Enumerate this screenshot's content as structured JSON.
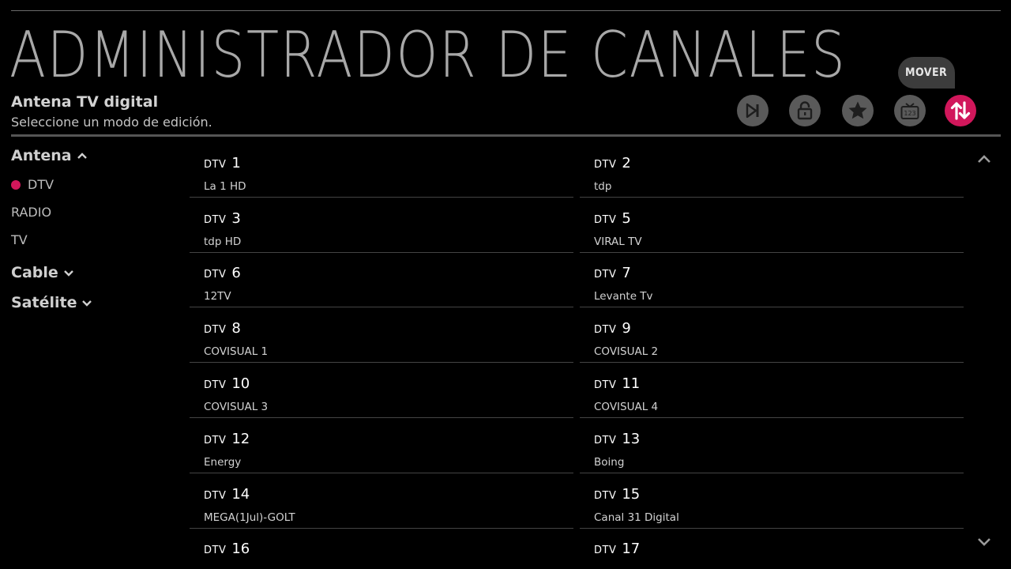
{
  "header": {
    "title": "ADMINISTRADOR DE CANALES",
    "source": "Antena TV digital",
    "subtitle": "Seleccione un modo de edición."
  },
  "toolbar": {
    "tooltip": "MOVER",
    "buttons": [
      {
        "name": "skip",
        "icon": "skip-icon"
      },
      {
        "name": "lock",
        "icon": "lock-icon"
      },
      {
        "name": "favorite",
        "icon": "star-icon"
      },
      {
        "name": "number",
        "icon": "tv-number-icon"
      },
      {
        "name": "move",
        "icon": "move-arrows-icon",
        "active": true
      }
    ],
    "accent_color": "#d1175b"
  },
  "sidebar": {
    "groups": [
      {
        "label": "Antena",
        "expanded": true,
        "items": [
          "DTV",
          "RADIO",
          "TV"
        ],
        "selected": "DTV"
      },
      {
        "label": "Cable",
        "expanded": false
      },
      {
        "label": "Satélite",
        "expanded": false
      }
    ]
  },
  "channels": [
    {
      "type": "DTV",
      "number": "1",
      "name": "La 1 HD"
    },
    {
      "type": "DTV",
      "number": "2",
      "name": "tdp"
    },
    {
      "type": "DTV",
      "number": "3",
      "name": "tdp HD"
    },
    {
      "type": "DTV",
      "number": "5",
      "name": "VIRAL TV"
    },
    {
      "type": "DTV",
      "number": "6",
      "name": "12TV"
    },
    {
      "type": "DTV",
      "number": "7",
      "name": "Levante Tv"
    },
    {
      "type": "DTV",
      "number": "8",
      "name": "COVISUAL 1"
    },
    {
      "type": "DTV",
      "number": "9",
      "name": "COVISUAL 2"
    },
    {
      "type": "DTV",
      "number": "10",
      "name": "COVISUAL 3"
    },
    {
      "type": "DTV",
      "number": "11",
      "name": "COVISUAL 4"
    },
    {
      "type": "DTV",
      "number": "12",
      "name": "Energy"
    },
    {
      "type": "DTV",
      "number": "13",
      "name": "Boing"
    },
    {
      "type": "DTV",
      "number": "14",
      "name": "MEGA(1Jul)-GOLT"
    },
    {
      "type": "DTV",
      "number": "15",
      "name": "Canal 31 Digital"
    },
    {
      "type": "DTV",
      "number": "16",
      "name": ""
    },
    {
      "type": "DTV",
      "number": "17",
      "name": ""
    }
  ]
}
